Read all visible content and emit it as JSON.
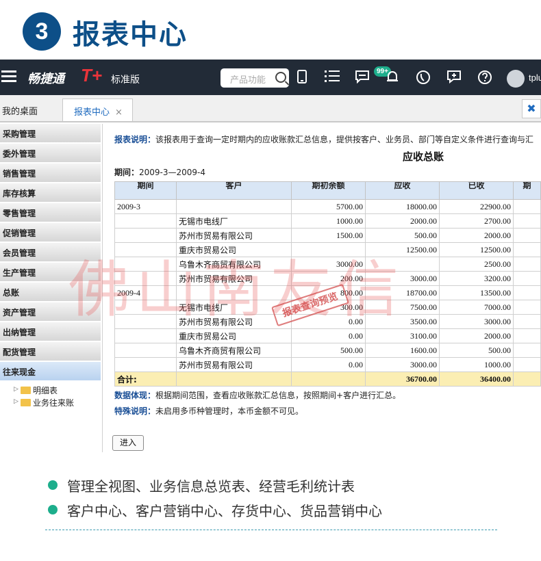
{
  "header": {
    "number": "3",
    "title": "报表中心"
  },
  "topbar": {
    "brand": "畅捷通",
    "brand_t": "T+",
    "edition": "标准版",
    "search_placeholder": "产品功能",
    "badge": "99+",
    "user": "tplu"
  },
  "tabs": {
    "home": "我的桌面",
    "report": "报表中心",
    "close": "×",
    "close_all": "✖"
  },
  "sidebar": {
    "items": [
      "采购管理",
      "委外管理",
      "销售管理",
      "库存核算",
      "零售管理",
      "促销管理",
      "会员管理",
      "生产管理",
      "总账",
      "资产管理",
      "出纳管理",
      "配货管理",
      "往来现金"
    ],
    "active": "往来现金",
    "tree": [
      "明细表",
      "业务往来账"
    ]
  },
  "report": {
    "desc_label": "报表说明：",
    "desc": "该报表用于查询一定时期内的应收账款汇总信息，提供按客户、业务员、部门等自定义条件进行查询与汇",
    "title": "应收总账",
    "period_label": "期间：",
    "period": "2009-3—2009-4",
    "columns": [
      "期间",
      "客户",
      "期初余额",
      "应收",
      "已收",
      "期"
    ],
    "rows": [
      [
        "2009-3",
        "",
        "5700.00",
        "18000.00",
        "22900.00"
      ],
      [
        "",
        "无锡市电线厂",
        "1000.00",
        "2000.00",
        "2700.00"
      ],
      [
        "",
        "苏州市贸易有限公司",
        "1500.00",
        "500.00",
        "2000.00"
      ],
      [
        "",
        "重庆市贸易公司",
        "",
        "12500.00",
        "12500.00"
      ],
      [
        "",
        "乌鲁木齐商贸有限公司",
        "3000.00",
        "",
        "2500.00"
      ],
      [
        "",
        "苏州市贸易有限公司",
        "200.00",
        "3000.00",
        "3200.00"
      ],
      [
        "2009-4",
        "",
        "800.00",
        "18700.00",
        "13500.00"
      ],
      [
        "",
        "无锡市电线厂",
        "300.00",
        "7500.00",
        "7000.00"
      ],
      [
        "",
        "苏州市贸易有限公司",
        "0.00",
        "3500.00",
        "3000.00"
      ],
      [
        "",
        "重庆市贸易公司",
        "0.00",
        "3100.00",
        "2000.00"
      ],
      [
        "",
        "乌鲁木齐商贸有限公司",
        "500.00",
        "1600.00",
        "500.00"
      ],
      [
        "",
        "苏州市贸易有限公司",
        "0.00",
        "3000.00",
        "1000.00"
      ]
    ],
    "total": [
      "合计:",
      "",
      "",
      "36700.00",
      "36400.00"
    ],
    "data_label": "数据体现：",
    "data_text": "根据期间范围，查看应收账款汇总信息，按照期间+客户进行汇总。",
    "special_label": "特殊说明：",
    "special_text": "未启用多币种管理时，本币金额不可见。",
    "enter_button": "进入"
  },
  "watermark": {
    "text": "佛山南友信",
    "stamp": "报表查询预览"
  },
  "features": [
    "管理全视图、业务信息总览表、经营毛利统计表",
    "客户中心、客户营销中心、存货中心、货品营销中心"
  ],
  "colors": {
    "accent": "#0d4f88",
    "topbar": "#222b37",
    "green": "#1dae8c",
    "total_row": "#fbeeb3"
  }
}
